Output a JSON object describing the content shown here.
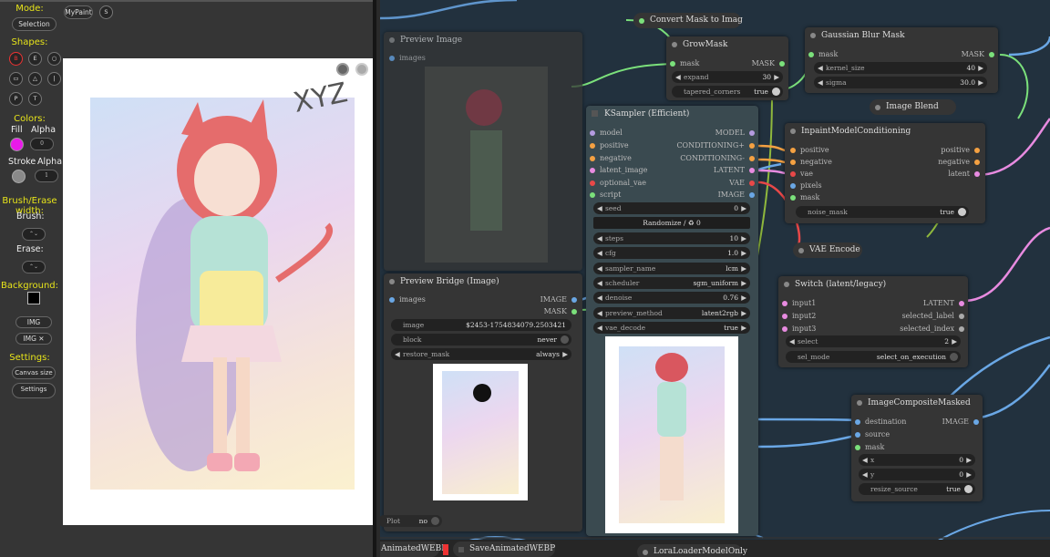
{
  "painter": {
    "mode_label": "Mode:",
    "mode_value": "Selection",
    "mypaint": "MyPaint",
    "s_btn": "S",
    "shapes_label": "Shapes:",
    "shapes": [
      "B",
      "E",
      "○",
      "▭",
      "△",
      "|",
      "P",
      "T"
    ],
    "colors_label": "Colors:",
    "fill_label": "Fill",
    "alpha_label": "Alpha",
    "fill_color": "#e91ae9",
    "fill_alpha": "0",
    "stroke_label": "Stroke",
    "stroke_alpha_label": "Alpha",
    "stroke_color": "#8a8a8a",
    "stroke_alpha": "1",
    "brush_erase_label": "Brush/Erase width:",
    "brush_label": "Brush:",
    "erase_label": "Erase:",
    "background_label": "Background:",
    "bg_color": "#000000",
    "img_btn": "IMG",
    "img_x_btn": "IMG ✕",
    "settings_label": "Settings:",
    "canvas_size": "Canvas size",
    "settings_btn": "Settings",
    "signature": "XYZ"
  },
  "graph": {
    "preview_image": {
      "title": "Preview Image",
      "input": "images"
    },
    "preview_bridge": {
      "title": "Preview Bridge (Image)",
      "input": "images",
      "out1": "IMAGE",
      "out2": "MASK",
      "image_label": "image",
      "image_value": "$2453-1754834079.2503421",
      "block_label": "block",
      "block_value": "never",
      "restore_label": "restore_mask",
      "restore_value": "always",
      "plot_label": "Plot",
      "plot_value": "no"
    },
    "convert_mask": {
      "title": "Convert Mask to Imag"
    },
    "grow_mask": {
      "title": "GrowMask",
      "in": "mask",
      "out": "MASK",
      "expand_label": "expand",
      "expand_value": "30",
      "taper_label": "tapered_corners",
      "taper_value": "true"
    },
    "gaussian": {
      "title": "Gaussian Blur Mask",
      "in": "mask",
      "out": "MASK",
      "k_label": "kernel_size",
      "k_value": "40",
      "s_label": "sigma",
      "s_value": "30.0"
    },
    "image_blend": {
      "title": "Image Blend"
    },
    "inpaint": {
      "title": "InpaintModelConditioning",
      "ins": [
        "positive",
        "negative",
        "vae",
        "pixels",
        "mask"
      ],
      "outs": [
        "positive",
        "negative",
        "latent"
      ],
      "noise_label": "noise_mask",
      "noise_value": "true"
    },
    "vae_encode": {
      "title": "VAE Encode"
    },
    "switch": {
      "title": "Switch (latent/legacy)",
      "ins": [
        "input1",
        "input2",
        "input3"
      ],
      "outs": [
        "LATENT",
        "selected_label",
        "selected_index"
      ],
      "select_label": "select",
      "select_value": "2",
      "sel_mode_label": "sel_mode",
      "sel_mode_value": "select_on_execution"
    },
    "composite": {
      "title": "ImageCompositeMasked",
      "ins": [
        "destination",
        "source",
        "mask"
      ],
      "out": "IMAGE",
      "x_label": "x",
      "x_value": "0",
      "y_label": "y",
      "y_value": "0",
      "resize_label": "resize_source",
      "resize_value": "true"
    },
    "ksampler": {
      "title": "KSampler (Efficient)",
      "ins": [
        "model",
        "positive",
        "negative",
        "latent_image",
        "optional_vae",
        "script"
      ],
      "outs": [
        "MODEL",
        "CONDITIONING+",
        "CONDITIONING-",
        "LATENT",
        "VAE",
        "IMAGE"
      ],
      "seed_label": "seed",
      "seed_value": "0",
      "randomize": "Randomize / ♻ 0",
      "steps_label": "steps",
      "steps_value": "10",
      "cfg_label": "cfg",
      "cfg_value": "1.0",
      "sampler_label": "sampler_name",
      "sampler_value": "lcm",
      "scheduler_label": "scheduler",
      "scheduler_value": "sgm_uniform",
      "denoise_label": "denoise",
      "denoise_value": "0.76",
      "preview_label": "preview_method",
      "preview_value": "latent2rgb",
      "vae_decode_label": "vae_decode",
      "vae_decode_value": "true"
    },
    "bottom": {
      "animated": "AnimatedWEBP",
      "save_animated": "SaveAnimatedWEBP",
      "lora": "LoraLoaderModelOnly"
    }
  }
}
